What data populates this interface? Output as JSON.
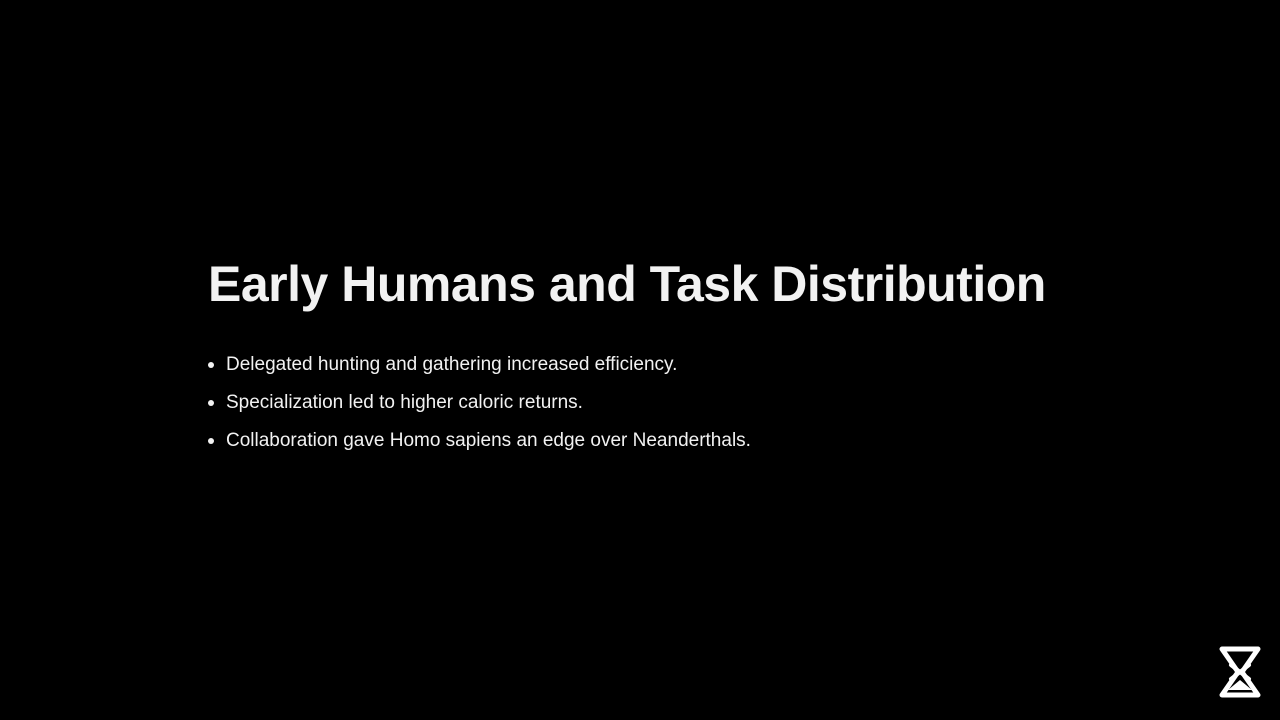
{
  "slide": {
    "title": "Early Humans and Task Distribution",
    "bullets": [
      "Delegated hunting and gathering increased efficiency.",
      "Specialization led to higher caloric returns.",
      "Collaboration gave Homo sapiens an edge over Neanderthals."
    ]
  },
  "logo": {
    "icon": "hourglass-x-logo-icon"
  },
  "colors": {
    "background": "#000000",
    "text": "#f2f2f2"
  }
}
